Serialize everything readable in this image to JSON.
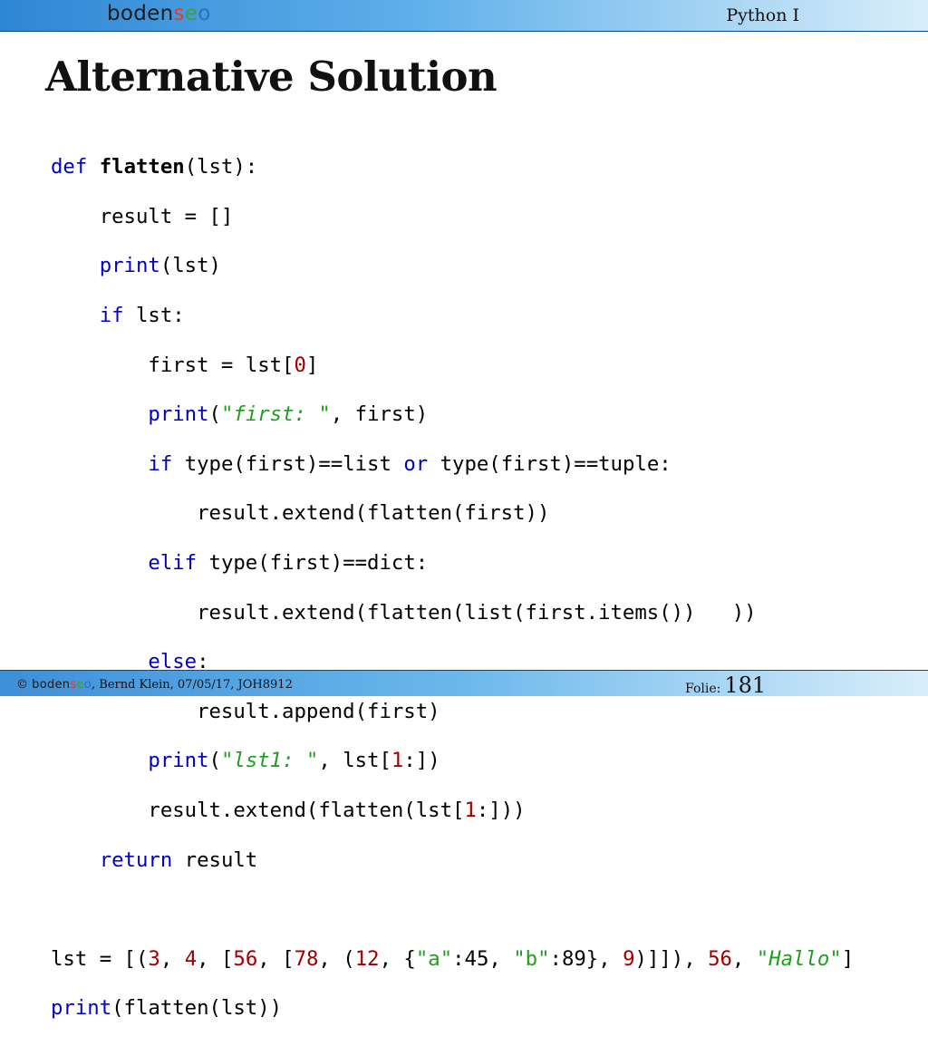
{
  "header": {
    "logo": {
      "part1": "boden",
      "part2": "s",
      "part3": "e",
      "part4": "o"
    },
    "course_title": "Python I"
  },
  "slide": {
    "title": "Alternative Solution"
  },
  "code": {
    "l1": {
      "kw": "def",
      "fn": "flatten",
      "rest": "(lst):"
    },
    "l2": {
      "text": "    result = []"
    },
    "l3": {
      "indent": "    ",
      "kw": "print",
      "rest": "(lst)"
    },
    "l4": {
      "indent": "    ",
      "kw": "if",
      "rest": " lst:"
    },
    "l5": {
      "pre": "        first = lst[",
      "num": "0",
      "post": "]"
    },
    "l6": {
      "indent": "        ",
      "kw": "print",
      "open": "(",
      "str": "\"first: \"",
      "rest": ", first)"
    },
    "l7": {
      "indent": "        ",
      "kw": "if",
      "mid": " type(first)==list ",
      "kw2": "or",
      "rest": " type(first)==tuple:"
    },
    "l8": {
      "text": "            result.extend(flatten(first))"
    },
    "l9": {
      "indent": "        ",
      "kw": "elif",
      "rest": " type(first)==dict:"
    },
    "l10": {
      "text": "            result.extend(flatten(list(first.items())   ))"
    },
    "l11": {
      "indent": "        ",
      "kw": "else",
      "rest": ":"
    },
    "l12": {
      "text": "            result.append(first)"
    },
    "l13": {
      "indent": "        ",
      "kw": "print",
      "open": "(",
      "str": "\"lst1: \"",
      "mid": ", lst[",
      "num": "1",
      "rest": ":])"
    },
    "l14": {
      "pre": "        result.extend(flatten(lst[",
      "num": "1",
      "post": ":]))"
    },
    "l15": {
      "indent": "    ",
      "kw": "return",
      "rest": " result"
    },
    "l17": {
      "t1": "lst = [(",
      "n1": "3",
      "t2": ", ",
      "n2": "4",
      "t3": ", [",
      "n3": "56",
      "t4": ", [",
      "n4": "78",
      "t5": ", (",
      "n5": "12",
      "t6": ", {",
      "s1": "\"a\"",
      "t7": ":45, ",
      "s2": "\"b\"",
      "t8": ":89}, ",
      "n6": "9",
      "t9": ")]]), ",
      "n7": "56",
      "t10": ", ",
      "s3": "\"Hallo\"",
      "t11": "]"
    },
    "l18": {
      "kw": "print",
      "rest": "(flatten(lst))"
    }
  },
  "footer": {
    "copyright": "© ",
    "logo": {
      "part1": "boden",
      "part2": "s",
      "part3": "e",
      "part4": "o"
    },
    "info": ", Bernd Klein, 07/05/17, JOH8912",
    "slide_label": "Folie:",
    "slide_number": "181"
  }
}
